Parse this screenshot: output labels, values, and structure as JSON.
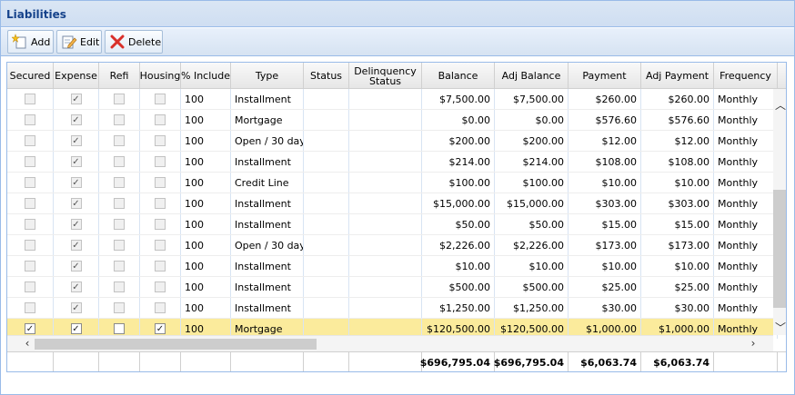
{
  "panel": {
    "title": "Liabilities"
  },
  "toolbar": {
    "add_label": "Add",
    "edit_label": "Edit",
    "delete_label": "Delete"
  },
  "columns": [
    "Secured",
    "Expense",
    "Refi",
    "Housing",
    "% Include",
    "Type",
    "Status",
    "Delinquency Status",
    "Balance",
    "Adj Balance",
    "Payment",
    "Adj Payment",
    "Frequency"
  ],
  "rows": [
    {
      "secured": false,
      "expense": true,
      "refi": false,
      "housing": false,
      "include": "100",
      "type": "Installment",
      "status": "",
      "delinquency": "",
      "balance": "$7,500.00",
      "adj_balance": "$7,500.00",
      "payment": "$260.00",
      "adj_payment": "$260.00",
      "frequency": "Monthly",
      "selected": false
    },
    {
      "secured": false,
      "expense": true,
      "refi": false,
      "housing": false,
      "include": "100",
      "type": "Mortgage",
      "status": "",
      "delinquency": "",
      "balance": "$0.00",
      "adj_balance": "$0.00",
      "payment": "$576.60",
      "adj_payment": "$576.60",
      "frequency": "Monthly",
      "selected": false
    },
    {
      "secured": false,
      "expense": true,
      "refi": false,
      "housing": false,
      "include": "100",
      "type": "Open / 30 day",
      "status": "",
      "delinquency": "",
      "balance": "$200.00",
      "adj_balance": "$200.00",
      "payment": "$12.00",
      "adj_payment": "$12.00",
      "frequency": "Monthly",
      "selected": false
    },
    {
      "secured": false,
      "expense": true,
      "refi": false,
      "housing": false,
      "include": "100",
      "type": "Installment",
      "status": "",
      "delinquency": "",
      "balance": "$214.00",
      "adj_balance": "$214.00",
      "payment": "$108.00",
      "adj_payment": "$108.00",
      "frequency": "Monthly",
      "selected": false
    },
    {
      "secured": false,
      "expense": true,
      "refi": false,
      "housing": false,
      "include": "100",
      "type": "Credit Line",
      "status": "",
      "delinquency": "",
      "balance": "$100.00",
      "adj_balance": "$100.00",
      "payment": "$10.00",
      "adj_payment": "$10.00",
      "frequency": "Monthly",
      "selected": false
    },
    {
      "secured": false,
      "expense": true,
      "refi": false,
      "housing": false,
      "include": "100",
      "type": "Installment",
      "status": "",
      "delinquency": "",
      "balance": "$15,000.00",
      "adj_balance": "$15,000.00",
      "payment": "$303.00",
      "adj_payment": "$303.00",
      "frequency": "Monthly",
      "selected": false
    },
    {
      "secured": false,
      "expense": true,
      "refi": false,
      "housing": false,
      "include": "100",
      "type": "Installment",
      "status": "",
      "delinquency": "",
      "balance": "$50.00",
      "adj_balance": "$50.00",
      "payment": "$15.00",
      "adj_payment": "$15.00",
      "frequency": "Monthly",
      "selected": false
    },
    {
      "secured": false,
      "expense": true,
      "refi": false,
      "housing": false,
      "include": "100",
      "type": "Open / 30 day",
      "status": "",
      "delinquency": "",
      "balance": "$2,226.00",
      "adj_balance": "$2,226.00",
      "payment": "$173.00",
      "adj_payment": "$173.00",
      "frequency": "Monthly",
      "selected": false
    },
    {
      "secured": false,
      "expense": true,
      "refi": false,
      "housing": false,
      "include": "100",
      "type": "Installment",
      "status": "",
      "delinquency": "",
      "balance": "$10.00",
      "adj_balance": "$10.00",
      "payment": "$10.00",
      "adj_payment": "$10.00",
      "frequency": "Monthly",
      "selected": false
    },
    {
      "secured": false,
      "expense": true,
      "refi": false,
      "housing": false,
      "include": "100",
      "type": "Installment",
      "status": "",
      "delinquency": "",
      "balance": "$500.00",
      "adj_balance": "$500.00",
      "payment": "$25.00",
      "adj_payment": "$25.00",
      "frequency": "Monthly",
      "selected": false
    },
    {
      "secured": false,
      "expense": true,
      "refi": false,
      "housing": false,
      "include": "100",
      "type": "Installment",
      "status": "",
      "delinquency": "",
      "balance": "$1,250.00",
      "adj_balance": "$1,250.00",
      "payment": "$30.00",
      "adj_payment": "$30.00",
      "frequency": "Monthly",
      "selected": false
    },
    {
      "secured": true,
      "expense": true,
      "refi": false,
      "housing": true,
      "include": "100",
      "type": "Mortgage",
      "status": "",
      "delinquency": "",
      "balance": "$120,500.00",
      "adj_balance": "$120,500.00",
      "payment": "$1,000.00",
      "adj_payment": "$1,000.00",
      "frequency": "Monthly",
      "selected": true
    }
  ],
  "totals": {
    "balance": "$696,795.04",
    "adj_balance": "$696,795.04",
    "payment": "$6,063.74",
    "adj_payment": "$6,063.74"
  },
  "colors": {
    "header_text": "#15428b",
    "border": "#99bbe8",
    "selected_row": "#fbeb9c",
    "delete_icon": "#d9302a"
  },
  "icons": {
    "add": "add-icon",
    "edit": "edit-icon",
    "delete": "delete-icon"
  }
}
